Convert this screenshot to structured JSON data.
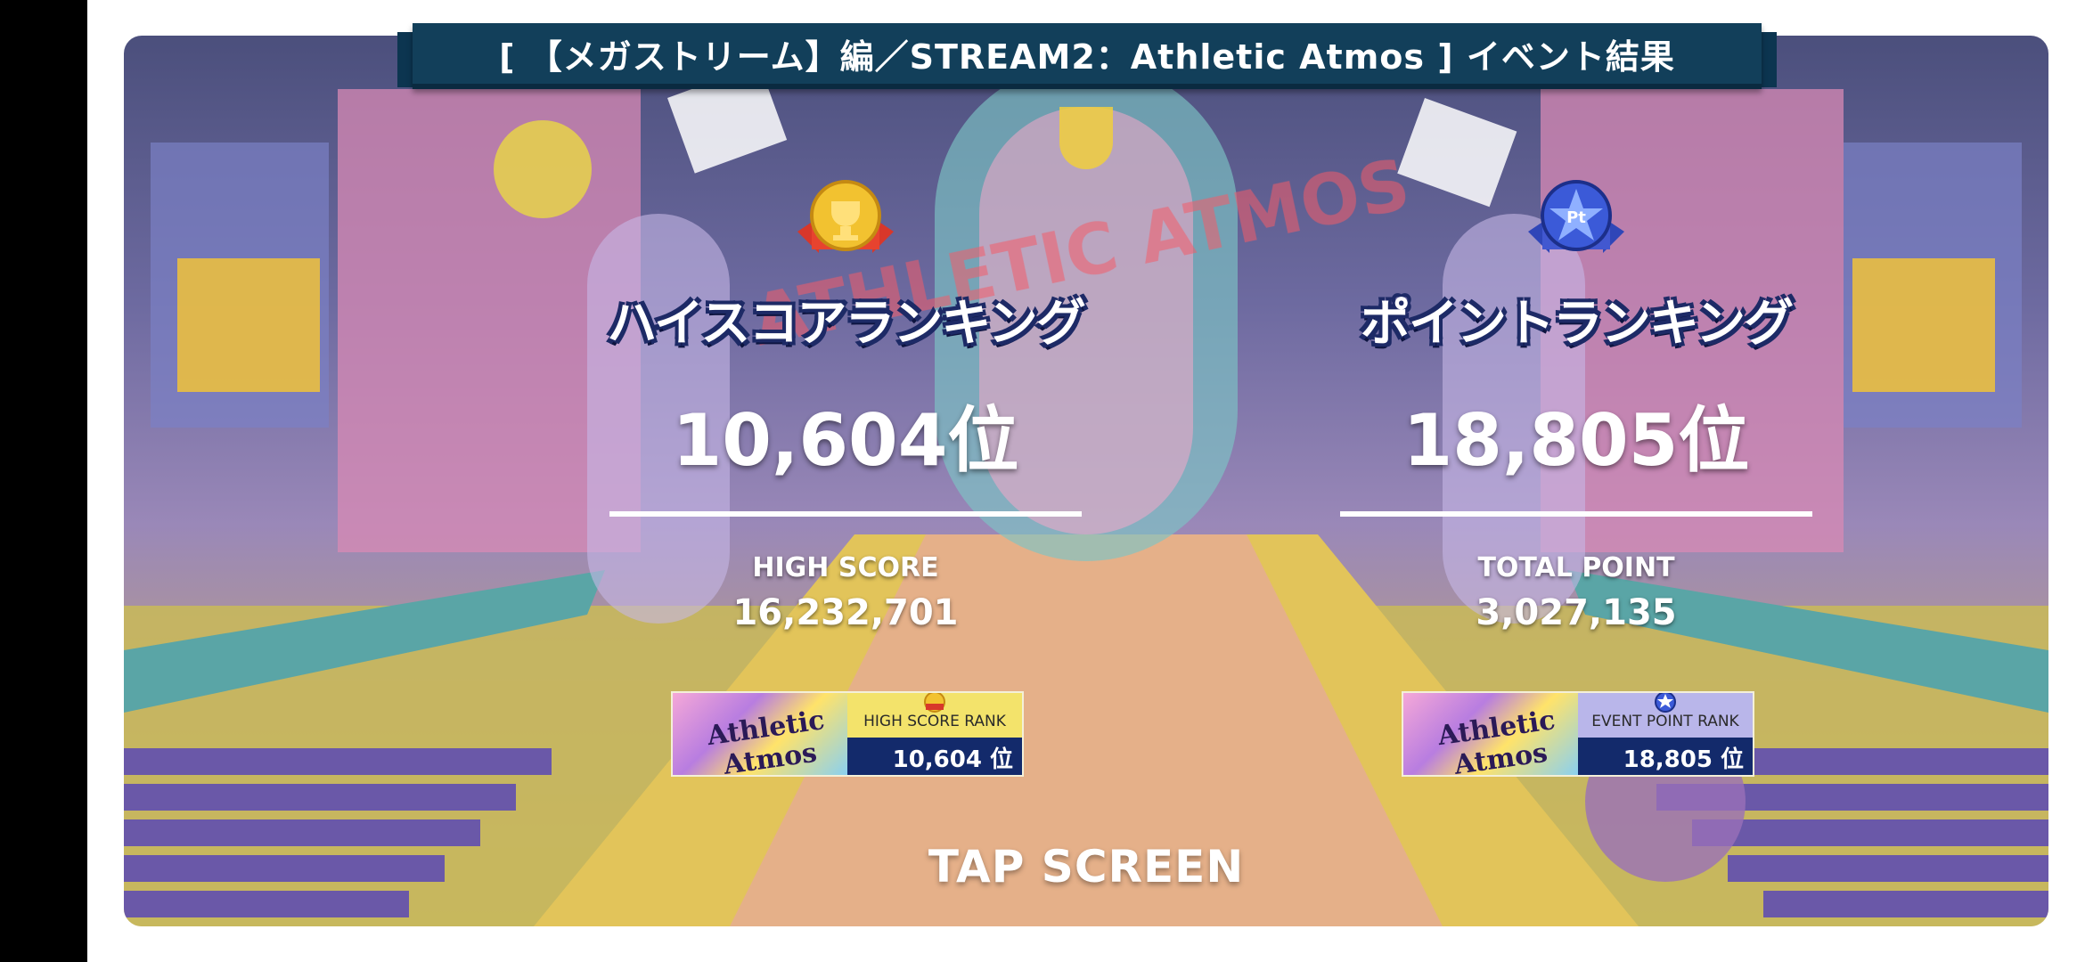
{
  "title": "[ 【メガストリーム】編／STREAM2：Athletic Atmos ] イベント結果",
  "background_logo": "ATHLETIC ATMOS",
  "badge_art_text": "Athletic Atmos",
  "highscore": {
    "ranking_title": "ハイスコアランキング",
    "rank": "10,604位",
    "stat_label": "HIGH SCORE",
    "stat_value": "16,232,701",
    "badge_label": "HIGH SCORE RANK",
    "badge_rank": "10,604 位",
    "medal_icon": "gold-trophy-medal-icon",
    "medal_color": "#f2c230"
  },
  "points": {
    "ranking_title": "ポイントランキング",
    "rank": "18,805位",
    "stat_label": "TOTAL POINT",
    "stat_value": "3,027,135",
    "badge_label": "EVENT POINT RANK",
    "badge_rank": "18,805 位",
    "medal_icon": "blue-pt-star-medal-icon",
    "medal_color": "#3b5ad8"
  },
  "tap_prompt": "TAP SCREEN",
  "colors": {
    "title_bar": "#123f5a",
    "badge_gold": "#f3e36b",
    "badge_purple": "#b9b6ea"
  }
}
